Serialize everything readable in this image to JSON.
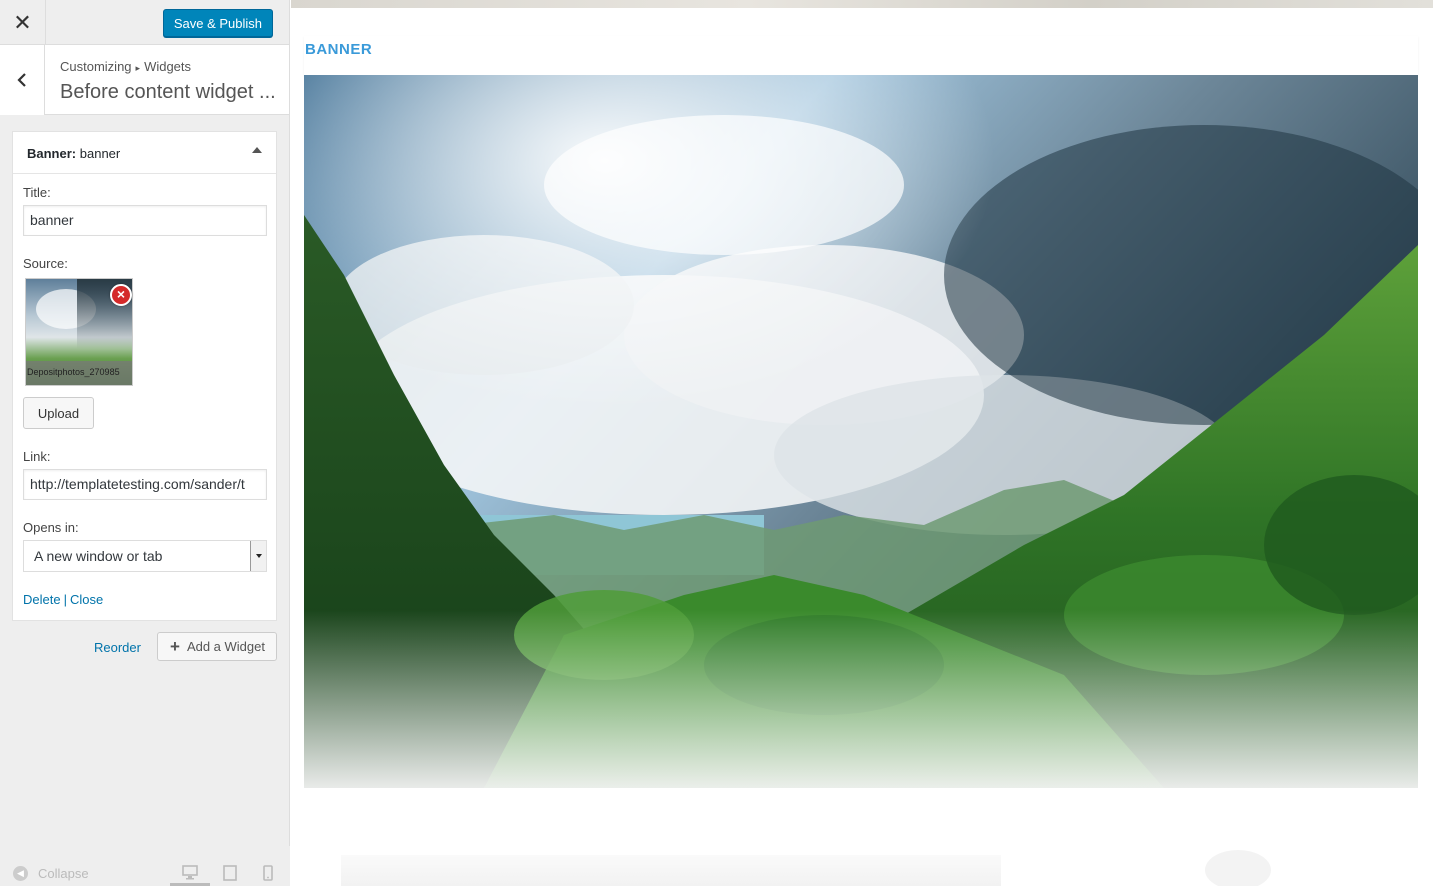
{
  "toolbar": {
    "close_icon": "close-icon",
    "publish_label": "Save & Publish"
  },
  "section": {
    "back_icon": "chevron-left-icon",
    "breadcrumb_root": "Customizing",
    "breadcrumb_child": "Widgets",
    "title": "Before content widget ..."
  },
  "widget": {
    "title_prefix": "Banner:",
    "title_name": "banner",
    "title_label": "Title:",
    "title_value": "banner",
    "source_label": "Source:",
    "image_caption": "Depositphotos_270985",
    "upload_label": "Upload",
    "link_label": "Link:",
    "link_value": "http://templatetesting.com/sander/t",
    "opens_label": "Opens in:",
    "opens_value": "A new window or tab",
    "delete_label": "Delete",
    "separator": "|",
    "close_label": "Close"
  },
  "panel": {
    "reorder_label": "Reorder",
    "add_widget_label": "Add a Widget"
  },
  "footer": {
    "collapse_label": "Collapse"
  },
  "preview": {
    "banner_heading": "BANNER"
  },
  "colors": {
    "accent": "#0085ba",
    "link": "#0073aa",
    "banner_heading": "#3a9ad9",
    "remove": "#d42a2a"
  }
}
